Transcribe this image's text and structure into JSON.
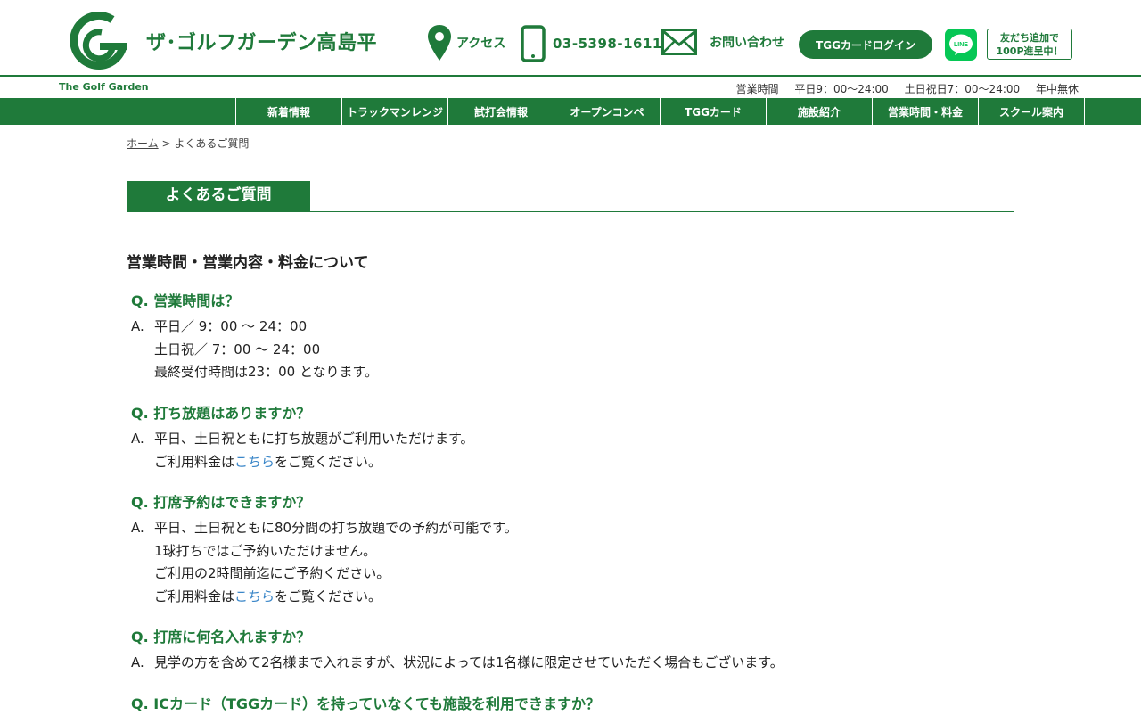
{
  "header": {
    "site_title": "ザ･ゴルフガーデン高島平",
    "brand_text": "The Golf Garden",
    "access_label": "アクセス",
    "phone_number": "03-5398-1611",
    "contact_label": "お問い合わせ",
    "login_label": "TGGカードログイン",
    "line_icon_text": "LINE",
    "friend_line1": "友だち追加で",
    "friend_line2": "100P進呈中！",
    "hours": {
      "label": "営業時間",
      "weekday": "平日9：00〜24:00",
      "weekend": "土日祝日7：00〜24:00",
      "holiday": "年中無休"
    }
  },
  "nav": {
    "items": [
      "新着情報",
      "トラックマンレンジ",
      "試打会情報",
      "オープンコンペ",
      "TGGカード",
      "施設紹介",
      "営業時間・料金",
      "スクール案内"
    ]
  },
  "breadcrumb": {
    "home": "ホーム",
    "sep": ">",
    "current": "よくあるご質問"
  },
  "page_title": "よくあるご質問",
  "section_title": "営業時間・営業内容・料金について",
  "faq": [
    {
      "q": "Q.  営業時間は？",
      "a_prefix": "A.",
      "a_lines": [
        "平日／ 9：00 〜 24：00",
        "土日祝／ 7：00 〜 24：00",
        "最終受付時間は23：00 となります。"
      ]
    },
    {
      "q": "Q.  打ち放題はありますか？",
      "a_prefix": "A.",
      "a_lines": [
        "平日、土日祝ともに打ち放題がご利用いただけます。"
      ],
      "a_link_line": {
        "before": "ご利用料金は",
        "link": "こちら",
        "after": "をご覧ください。"
      }
    },
    {
      "q": "Q.  打席予約はできますか？",
      "a_prefix": "A.",
      "a_lines": [
        "平日、土日祝ともに80分間の打ち放題での予約が可能です。",
        "1球打ちではご予約いただけません。",
        "ご利用の2時間前迄にご予約ください。"
      ],
      "a_link_line": {
        "before": "ご利用料金は",
        "link": "こちら",
        "after": "をご覧ください。"
      }
    },
    {
      "q": "Q.  打席に何名入れますか？",
      "a_prefix": "A.",
      "a_lines": [
        "見学の方を含めて2名様まで入れますが、状況によっては1名様に限定させていただく場合もございます。"
      ]
    },
    {
      "q": "Q.  ICカード（TGGカード）を持っていなくても施設を利用できますか？"
    }
  ],
  "colors": {
    "brand_green": "#1f7a3a",
    "link_blue": "#3a86c8",
    "line_green": "#06c755"
  }
}
